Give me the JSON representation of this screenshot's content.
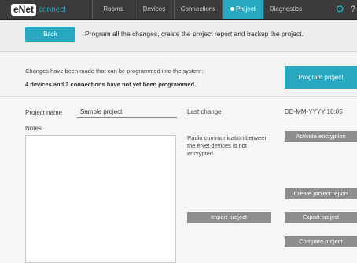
{
  "header": {
    "logo_text": "eNet",
    "logo_suffix": "connect",
    "tabs": [
      {
        "label": "Rooms"
      },
      {
        "label": "Devices"
      },
      {
        "label": "Connections"
      },
      {
        "label": "Project"
      },
      {
        "label": "Diagnostics"
      }
    ],
    "active_tab": "Project",
    "help_label": "?"
  },
  "subbar": {
    "back_label": "Back",
    "description": "Program  all the changes, create the project report and backup the project."
  },
  "notice": {
    "line1": "Changes have been made that can be programmed into the system:",
    "line2": "4 devices and 2 connections have not yet been programmed.",
    "program_button": "Program project"
  },
  "project": {
    "name_label": "Project name",
    "name_value": "Sample project",
    "last_change_label": "Last change",
    "last_change_value": "DD-MM-YYYY  10:05",
    "notes_label": "Notes",
    "notes_value": ""
  },
  "encryption": {
    "status_text": "Radio communication between the eNet devices is not encrypted.",
    "activate_button": "Activate encryption"
  },
  "actions": {
    "create_report": "Create project report",
    "import_project": "Import project",
    "export_project": "Export project",
    "compare_project": "Compare project"
  },
  "colors": {
    "accent": "#27a8c0",
    "topbar": "#3c3c3c",
    "button_gray": "#8e8e8e"
  }
}
